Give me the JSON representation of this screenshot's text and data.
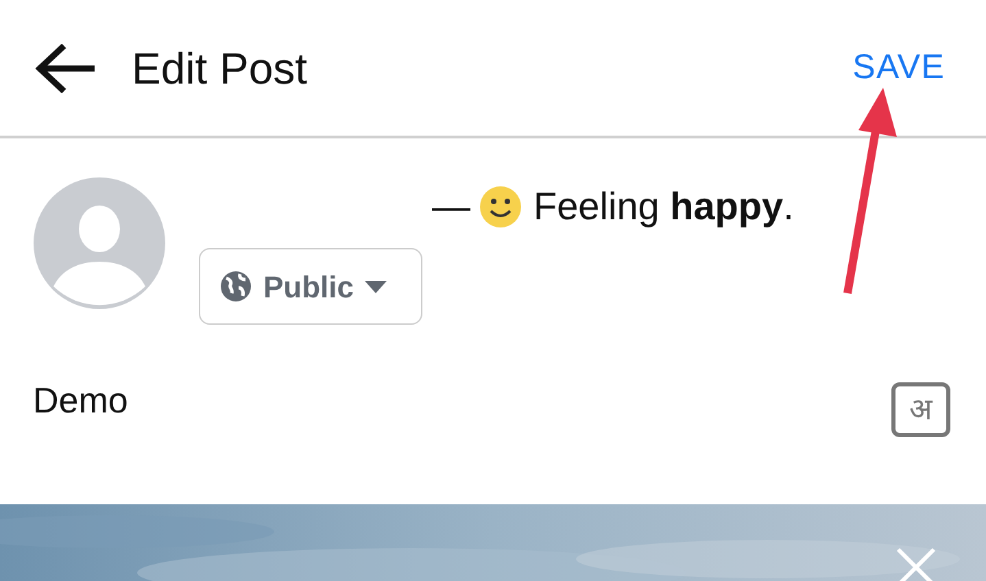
{
  "header": {
    "title": "Edit Post",
    "save": "SAVE"
  },
  "post": {
    "dash": "—",
    "feeling": "Feeling **happy**.",
    "audience": "Public",
    "text": "Demo",
    "language_key": "अ"
  }
}
